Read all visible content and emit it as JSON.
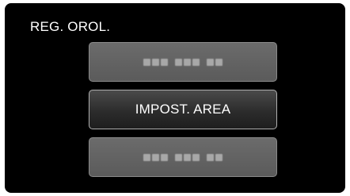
{
  "header": {
    "title": "REG. OROL."
  },
  "menu": {
    "items": [
      {
        "label": "",
        "state": "dimmed",
        "obscured": true,
        "groups": [
          3,
          3,
          2
        ]
      },
      {
        "label": "IMPOST. AREA",
        "state": "selected",
        "obscured": false
      },
      {
        "label": "",
        "state": "dimmed",
        "obscured": true,
        "groups": [
          3,
          3,
          2
        ]
      }
    ]
  },
  "colors": {
    "background": "#000000",
    "button_dim": "#636363",
    "button_selected": "#2c2c2c",
    "text": "#ffffff"
  }
}
